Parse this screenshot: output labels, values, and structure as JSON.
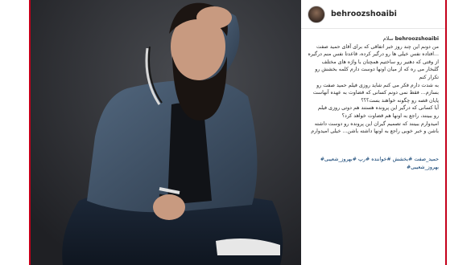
{
  "post": {
    "username": "behroozshoaibi",
    "caption_username": "behroozshoaibi",
    "caption_greeting": "سلام",
    "caption_lines": [
      "من دونم این چند روز خبر اتفاقی که برای آقای حمید صفت",
      "...افتاده نفس خیلی ها رو درگیر کرده، قاعدتا نفس منم درگیره",
      "از وقتی که دهنیر رو ساختیم همچنان با واژه های مختلف",
      "گلبخار می ره که از میان اونها دوست دارم کلمه بخشش رو",
      "تکرار کنم",
      "به شدت دارم فکر می کنم شاید روزی فیلم حمید صفت رو",
      "بسازم... فقط نمی دونم کسانی که قضاوت به عهده آنهاست",
      "پایان قصه رو چگونه خواهند بست؟؟؟",
      "آیا کسانی که درگیر این پرونده هستند هم دوتی روزی فیلم",
      "رو ببینند، راجع به اونها هم قضاوت خواهد کرد؟",
      "امیدوارم ببینند که تصمیم گیران این پرونده رو دوست داشته",
      "باشن و خبر خوبی راجع به اونها داشته باشن... خیلی امیدوارم"
    ],
    "hashtags": "حمید_صفت #بخشش #خواننده #رپ #بهروز_شعیبی#",
    "hashtag_tail": "بهروز_شعیبی#"
  },
  "colors": {
    "frame_border": "#c4001a",
    "hashtag": "#003569",
    "text": "#262626"
  }
}
